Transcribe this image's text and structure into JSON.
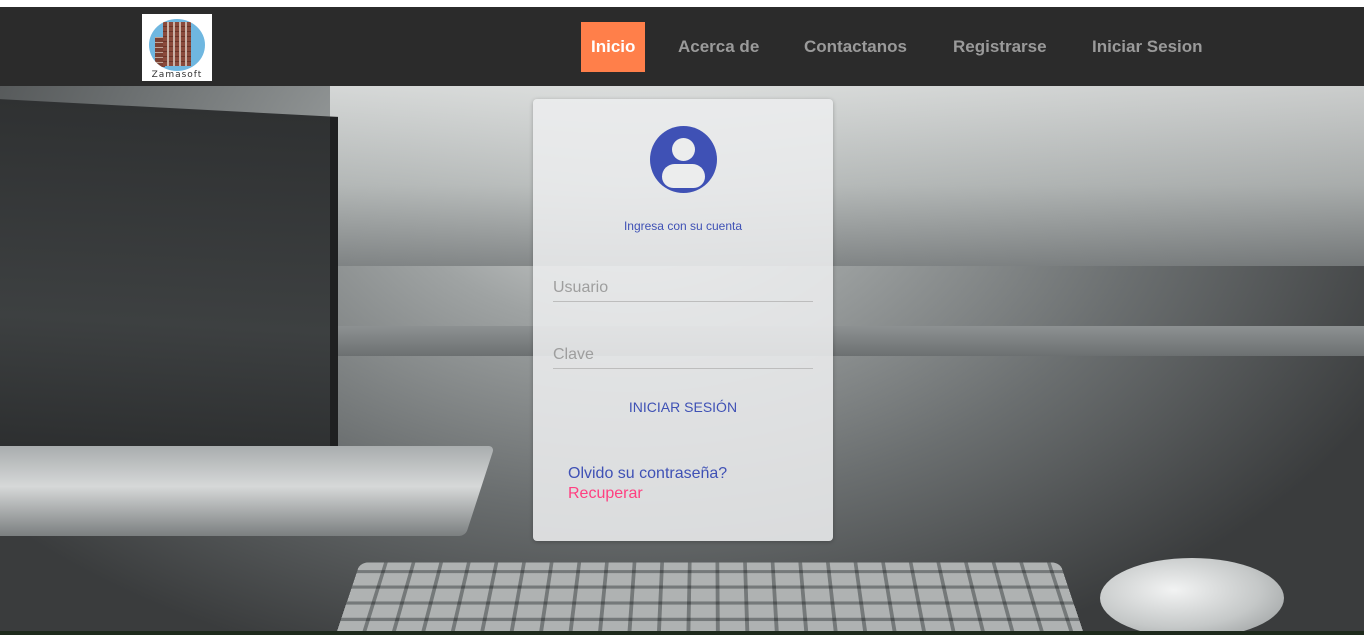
{
  "brand": {
    "logo_text": "Zamasoft"
  },
  "nav": {
    "items": [
      {
        "label": "Inicio"
      },
      {
        "label": "Acerca de"
      },
      {
        "label": "Contactanos"
      },
      {
        "label": "Registrarse"
      },
      {
        "label": "Iniciar Sesion"
      }
    ],
    "active_index": 0
  },
  "login": {
    "subtitle": "Ingresa con su cuenta",
    "username_placeholder": "Usuario",
    "password_placeholder": "Clave",
    "submit_label": "INICIAR SESIÓN",
    "forgot_text": "Olvido su contraseña?",
    "recover_label": "Recuperar"
  },
  "colors": {
    "nav_background": "#2b2b2b",
    "active_nav": "#ff7f4a",
    "primary": "#3f51b5",
    "accent": "#ff4081"
  },
  "icons": {
    "avatar": "account-circle-icon"
  }
}
